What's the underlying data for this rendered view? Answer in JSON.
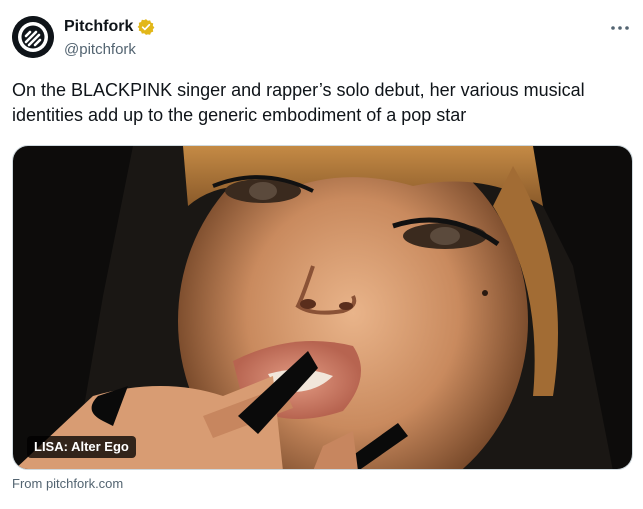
{
  "author": {
    "display_name": "Pitchfork",
    "handle": "@pitchfork",
    "verified_badge_color": "#e2b719",
    "avatar_icon": "pitchfork-logo-icon"
  },
  "more_icon": "ellipsis-icon",
  "tweet": {
    "text": "On the BLACKPINK singer and rapper’s solo debut, her various musical identities add up to the generic embodiment of a pop star"
  },
  "media": {
    "label": "LISA: Alter Ego",
    "description_icon": "photo-portrait"
  },
  "source": {
    "text": "From pitchfork.com"
  }
}
